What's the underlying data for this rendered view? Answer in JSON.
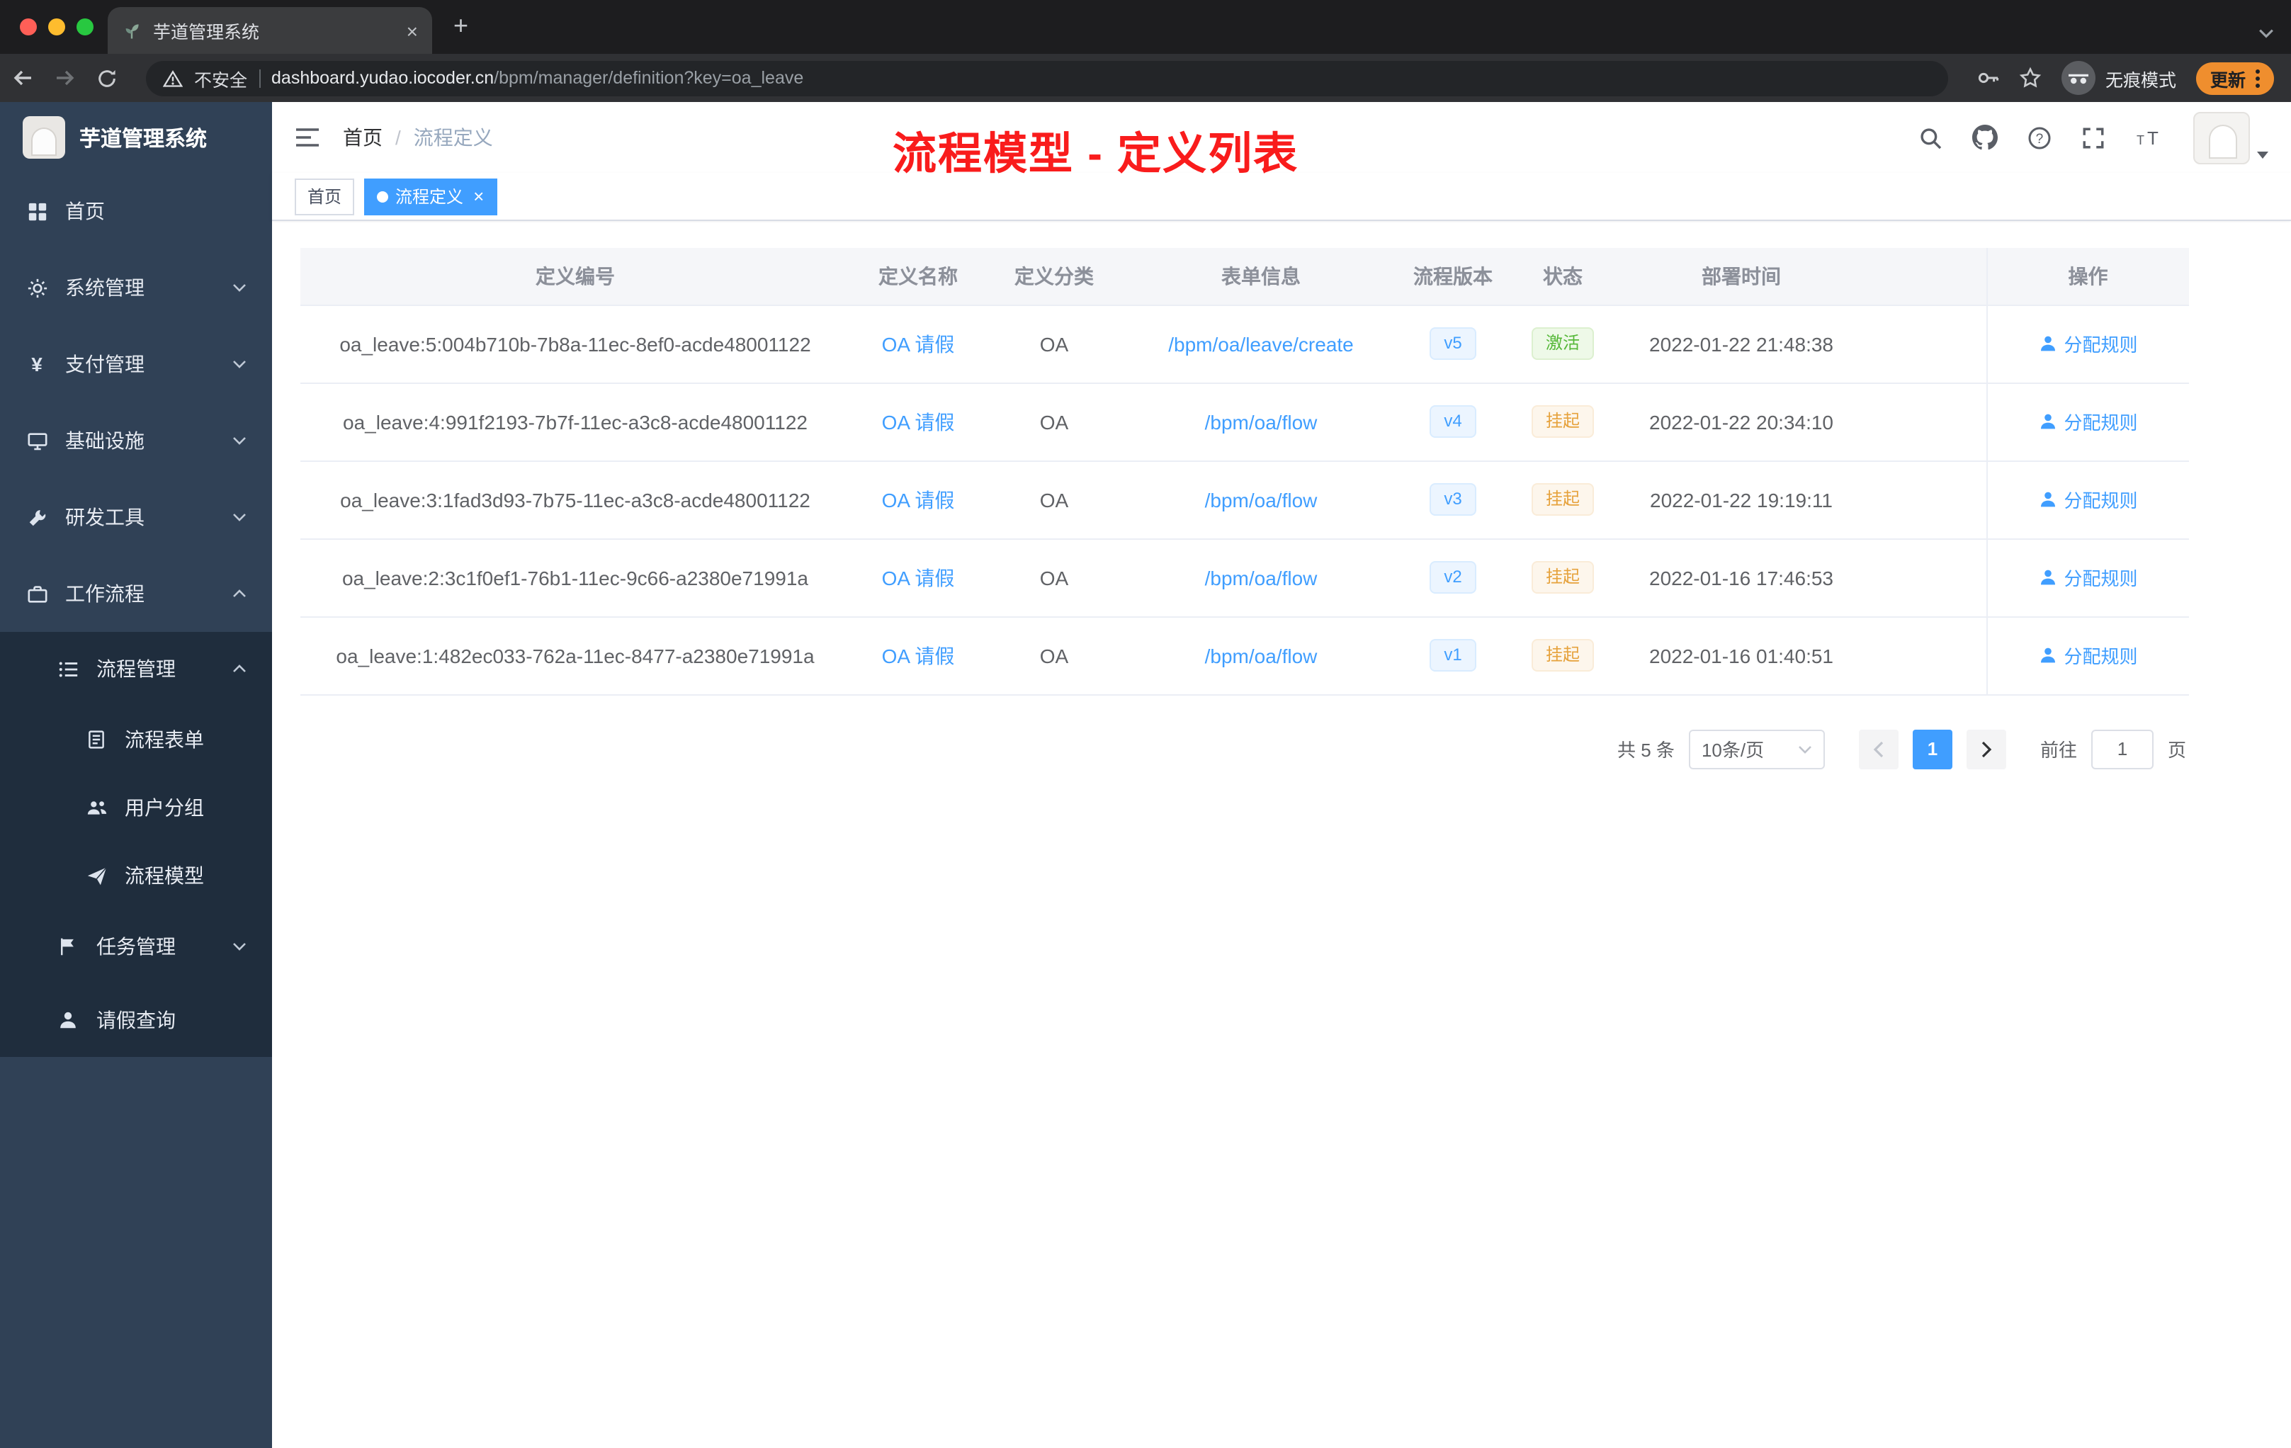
{
  "browser": {
    "tab_title": "芋道管理系统",
    "security_label": "不安全",
    "url_host": "dashboard.yudao.iocoder.cn",
    "url_path": "/bpm/manager/definition?key=oa_leave",
    "incognito_label": "无痕模式",
    "update_label": "更新"
  },
  "sidebar": {
    "logo_title": "芋道管理系统",
    "items": [
      {
        "label": "首页"
      },
      {
        "label": "系统管理"
      },
      {
        "label": "支付管理"
      },
      {
        "label": "基础设施"
      },
      {
        "label": "研发工具"
      },
      {
        "label": "工作流程"
      },
      {
        "label": "流程管理"
      },
      {
        "label": "流程表单"
      },
      {
        "label": "用户分组"
      },
      {
        "label": "流程模型"
      },
      {
        "label": "任务管理"
      },
      {
        "label": "请假查询"
      }
    ]
  },
  "navbar": {
    "breadcrumb": {
      "home": "首页",
      "separator": "/",
      "current": "流程定义"
    },
    "annotation": "流程模型 - 定义列表"
  },
  "tags": {
    "items": [
      {
        "label": "首页"
      },
      {
        "label": "流程定义",
        "close": "×"
      }
    ]
  },
  "table": {
    "columns": [
      "定义编号",
      "定义名称",
      "定义分类",
      "表单信息",
      "流程版本",
      "状态",
      "部署时间",
      "操作"
    ],
    "rows": [
      {
        "id": "oa_leave:5:004b710b-7b8a-11ec-8ef0-acde48001122",
        "name": "OA 请假",
        "category": "OA",
        "form": "/bpm/oa/leave/create",
        "version": "v5",
        "status": "激活",
        "deploy_time": "2022-01-22 21:48:38",
        "action": "分配规则"
      },
      {
        "id": "oa_leave:4:991f2193-7b7f-11ec-a3c8-acde48001122",
        "name": "OA 请假",
        "category": "OA",
        "form": "/bpm/oa/flow",
        "version": "v4",
        "status": "挂起",
        "deploy_time": "2022-01-22 20:34:10",
        "action": "分配规则"
      },
      {
        "id": "oa_leave:3:1fad3d93-7b75-11ec-a3c8-acde48001122",
        "name": "OA 请假",
        "category": "OA",
        "form": "/bpm/oa/flow",
        "version": "v3",
        "status": "挂起",
        "deploy_time": "2022-01-22 19:19:11",
        "action": "分配规则"
      },
      {
        "id": "oa_leave:2:3c1f0ef1-76b1-11ec-9c66-a2380e71991a",
        "name": "OA 请假",
        "category": "OA",
        "form": "/bpm/oa/flow",
        "version": "v2",
        "status": "挂起",
        "deploy_time": "2022-01-16 17:46:53",
        "action": "分配规则"
      },
      {
        "id": "oa_leave:1:482ec033-762a-11ec-8477-a2380e71991a",
        "name": "OA 请假",
        "category": "OA",
        "form": "/bpm/oa/flow",
        "version": "v1",
        "status": "挂起",
        "deploy_time": "2022-01-16 01:40:51",
        "action": "分配规则"
      }
    ]
  },
  "pagination": {
    "total": "共 5 条",
    "page_size": "10条/页",
    "current_page": "1",
    "jump_prefix": "前往",
    "jump_value": "1",
    "jump_suffix": "页"
  },
  "colors": {
    "accent": "#409eff",
    "success": "#55b838",
    "warning": "#e6a23c",
    "annotation": "#f91c1c",
    "sidebar": "#304156",
    "submenu": "#1f2d3d"
  }
}
